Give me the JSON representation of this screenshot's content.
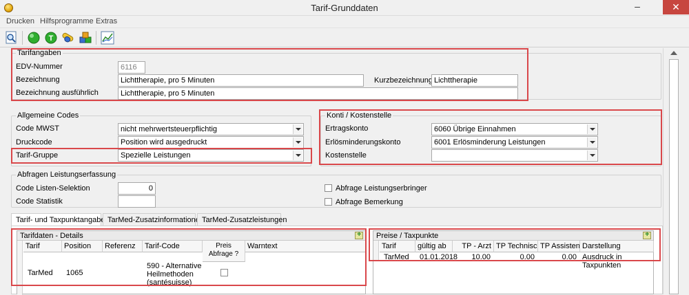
{
  "window": {
    "title": "Tarif-Grunddaten",
    "minimize": "–",
    "close": "✕"
  },
  "menu": [
    "Drucken",
    "Hilfsprogramme",
    "Extras"
  ],
  "toolbar": {
    "icons": [
      "search-preview-icon",
      "green-circle-icon",
      "green-t-icon",
      "pills-icon",
      "cubes-icon",
      "chart-icon"
    ]
  },
  "tarifangaben": {
    "title": "Tarifangaben",
    "edv_label": "EDV-Nummer",
    "edv_value": "6116",
    "bez_label": "Bezeichnung",
    "bez_value": "Lichttherapie, pro 5 Minuten",
    "kurz_label": "Kurzbezeichnung",
    "kurz_value": "Lichttherapie",
    "bez_ausf_label": "Bezeichnung ausführlich",
    "bez_ausf_value": "Lichttherapie, pro 5 Minuten"
  },
  "allgemeine_codes": {
    "title": "Allgemeine Codes",
    "mwst_label": "Code MWST",
    "mwst_value": "nicht mehrwertsteuerpflichtig",
    "druck_label": "Druckcode",
    "druck_value": "Position wird ausgedruckt",
    "gruppe_label": "Tarif-Gruppe",
    "gruppe_value": "Spezielle Leistungen"
  },
  "konti": {
    "title": "Konti / Kostenstelle",
    "ertrag_label": "Ertragskonto",
    "ertrag_value": "6060 Übrige Einnahmen",
    "erloes_label": "Erlösminderungskonto",
    "erloes_value": "6001 Erlösminderung Leistungen",
    "kosten_label": "Kostenstelle",
    "kosten_value": ""
  },
  "abfragen": {
    "title": "Abfragen Leistungserfassung",
    "listen_label": "Code Listen-Selektion",
    "listen_value": "0",
    "statistik_label": "Code Statistik",
    "statistik_value": "",
    "erbringer_label": "Abfrage Leistungserbringer",
    "bemerkung_label": "Abfrage Bemerkung"
  },
  "tabs": [
    "Tarif- und Taxpunktangaben",
    "TarMed-Zusatzinformationen",
    "TarMed-Zusatzleistungen"
  ],
  "details": {
    "title": "Tarifdaten - Details",
    "columns": [
      "Tarif",
      "Position",
      "Referenz",
      "Tarif-Code",
      "Preis\nAbfrage ?",
      "Warntext"
    ],
    "row": {
      "tarif": "TarMed",
      "position": "1065",
      "referenz": "",
      "code": "590 - Alternative\nHeilmethoden\n(santésuisse)",
      "warntext": ""
    }
  },
  "preise": {
    "title": "Preise / Taxpunkte",
    "columns": [
      "Tarif",
      "gültig ab",
      "TP - Arzt",
      "TP Technisch",
      "TP Assistent",
      "Darstellung"
    ],
    "row": {
      "tarif": "TarMed",
      "gueltig": "01.01.2018",
      "tp_arzt": "10.00",
      "tp_tech": "0.00",
      "tp_assist": "0.00",
      "darstellung": "Ausdruck in Taxpunkten"
    }
  }
}
